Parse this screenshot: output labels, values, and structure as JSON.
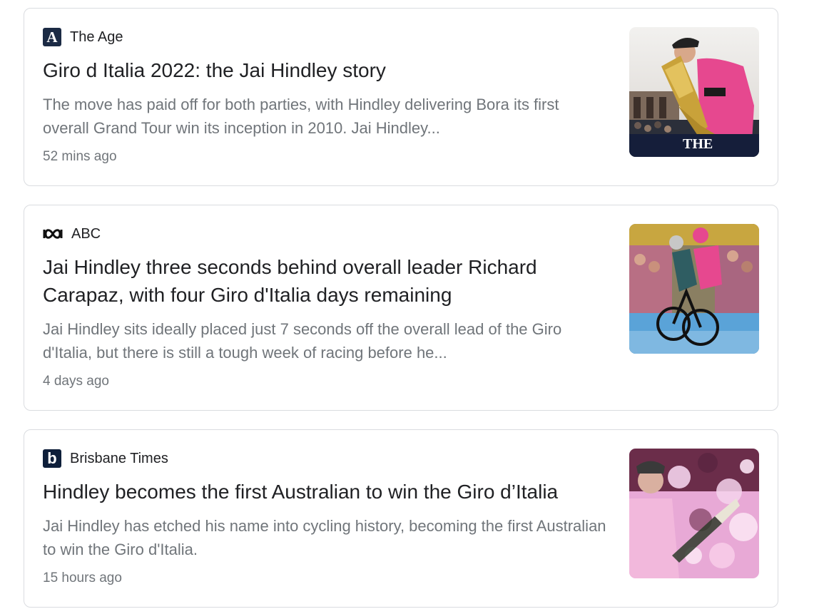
{
  "articles": [
    {
      "source": "The Age",
      "logo_icon": "the-age-logo-icon",
      "headline": "Giro d Italia 2022: the Jai Hindley story",
      "snippet": "The move has paid off for both parties, with Hindley delivering Bora its first overall Grand Tour win its inception in 2010. Jai Hindley...",
      "time": "52 mins ago",
      "thumbnail_watermark": "THE"
    },
    {
      "source": "ABC",
      "logo_icon": "abc-logo-icon",
      "headline": "Jai Hindley three seconds behind overall leader Richard Carapaz, with four Giro d'Italia days remaining",
      "snippet": "Jai Hindley sits ideally placed just 7 seconds off the overall lead of the Giro d'Italia, but there is still a tough week of racing before he...",
      "time": "4 days ago"
    },
    {
      "source": "Brisbane Times",
      "logo_icon": "brisbane-times-logo-icon",
      "headline": "Hindley becomes the first Australian to win the Giro d’Italia",
      "snippet": "Jai Hindley has etched his name into cycling history, becoming the first Australian to win the Giro d'Italia.",
      "time": "15 hours ago"
    }
  ],
  "colors": {
    "card_border": "#dadce0",
    "headline": "#202124",
    "secondary_text": "#70757a",
    "giro_pink": "#e6488f"
  }
}
